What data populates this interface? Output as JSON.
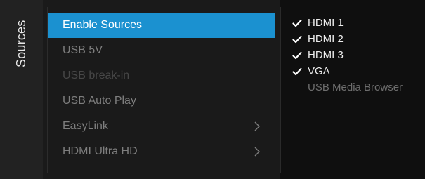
{
  "side_panel": {
    "title": "Sources"
  },
  "menu": {
    "items": [
      {
        "label": "Enable Sources",
        "state": "selected",
        "has_submenu": false
      },
      {
        "label": "USB 5V",
        "state": "normal",
        "has_submenu": false
      },
      {
        "label": "USB break-in",
        "state": "disabled",
        "has_submenu": false
      },
      {
        "label": "USB Auto Play",
        "state": "normal",
        "has_submenu": false
      },
      {
        "label": "EasyLink",
        "state": "normal",
        "has_submenu": true,
        "icon": "chevron-right-icon"
      },
      {
        "label": "HDMI Ultra HD",
        "state": "normal",
        "has_submenu": true,
        "icon": "chevron-right-icon"
      }
    ]
  },
  "sources": {
    "items": [
      {
        "label": "HDMI 1",
        "checked": true,
        "icon": "checkmark-icon"
      },
      {
        "label": "HDMI 2",
        "checked": true,
        "icon": "checkmark-icon"
      },
      {
        "label": "HDMI 3",
        "checked": true,
        "icon": "checkmark-icon"
      },
      {
        "label": "VGA",
        "checked": true,
        "icon": "checkmark-icon"
      },
      {
        "label": "USB Media Browser",
        "checked": false
      }
    ]
  },
  "colors": {
    "accent": "#1b91d0",
    "background": "#0b0b0b",
    "side_panel": "#222222",
    "menu_panel": "#1a1a1a",
    "text_active": "#ffffff",
    "text_normal": "#7e7e7e",
    "text_disabled": "#474747"
  }
}
